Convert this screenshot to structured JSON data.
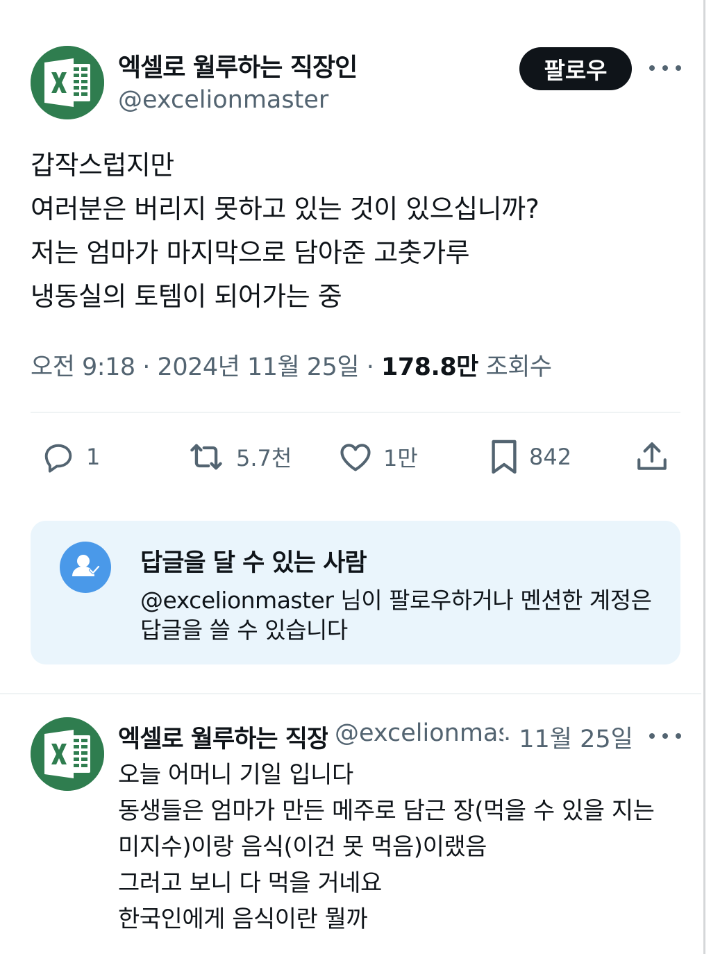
{
  "tweet": {
    "author_name": "엑셀로 월루하는 직장인",
    "author_handle": "@excelionmaster",
    "avatar_icon": "excel-logo-icon",
    "follow_label": "팔로우",
    "text_lines": [
      "갑작스럽지만",
      "여러분은 버리지 못하고 있는 것이 있으십니까?",
      "저는 엄마가 마지막으로 담아준 고춧가루",
      "냉동실의 토템이 되어가는 중"
    ],
    "time": "오전 9:18",
    "date": "2024년 11월 25일",
    "views_count": "178.8만",
    "views_label": "조회수",
    "separator": "·"
  },
  "actions": {
    "reply_count": "1",
    "retweet_count": "5.7천",
    "like_count": "1만",
    "bookmark_count": "842"
  },
  "reply_restriction": {
    "title": "답글을 달 수 있는 사람",
    "description": "@excelionmaster 님이 팔로우하거나 멘션한 계정은 답글을 쓸 수 있습니다"
  },
  "reply": {
    "author_name": "엑셀로 월루하는 직장인",
    "author_handle": "@excelionmaster",
    "date": "· 11월 25일",
    "text_lines": [
      "오늘 어머니 기일 입니다",
      "동생들은 엄마가 만든 메주로 담근 장(먹을 수 있을 지는 미지수)이랑 음식(이건 못 먹음)이랬음",
      "그러고 보니 다 먹을 거네요",
      "한국인에게 음식이란 뭘까"
    ]
  },
  "colors": {
    "text": "#0f1419",
    "secondary": "#536471",
    "excel_green": "#2f7d4f",
    "info_bg": "#eaf5fc",
    "info_icon": "#4a99e9"
  }
}
